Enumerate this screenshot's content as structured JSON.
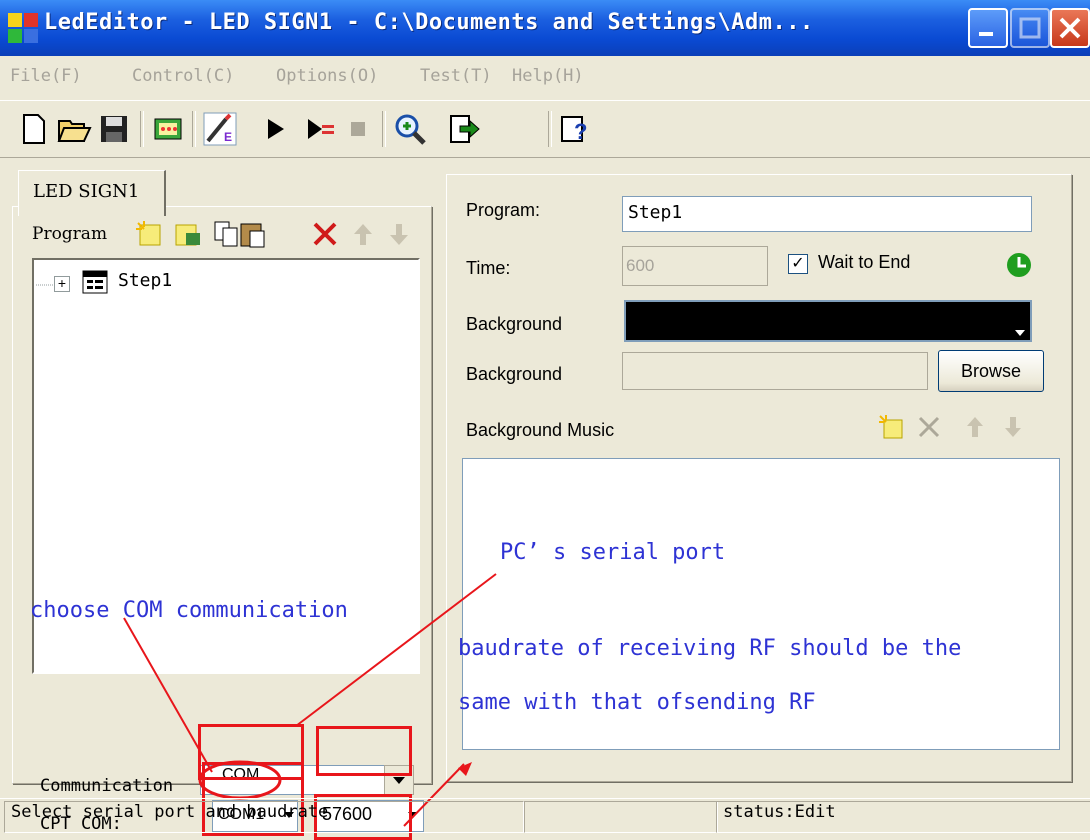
{
  "window": {
    "title": "LedEditor - LED SIGN1 - C:\\Documents and Settings\\Adm...",
    "icons": {
      "app": "led-app-icon",
      "minimize": "minimize-icon",
      "maximize": "maximize-icon",
      "close": "close-icon"
    }
  },
  "menu": [
    "File(F)",
    "Control(C)",
    "Options(O)",
    "Test(T)",
    "Help(H)"
  ],
  "toolbar": [
    "new-file-icon",
    "open-folder-icon",
    "save-disk-icon",
    "led-display-icon",
    "edit-wand-icon",
    "play-icon",
    "step-play-icon",
    "stop-icon",
    "zoom-icon",
    "export-icon",
    "help-icon"
  ],
  "left_panel": {
    "tab": "LED SIGN1",
    "program_label": "Program",
    "program_icons": [
      "new-program-icon",
      "new-sub-icon",
      "copy-icon",
      "paste-icon",
      "delete-icon",
      "move-up-icon",
      "move-down-icon"
    ],
    "tree": {
      "expander": "+",
      "item": "Step1"
    },
    "communication_label": "Communication",
    "communication_value": "COM",
    "cpt_label": "CPT COM:",
    "port_value": "COM1",
    "baud_value": "57600"
  },
  "right_panel": {
    "program_label": "Program:",
    "program_value": "Step1",
    "time_label": "Time:",
    "time_value": "600",
    "wait_checked": "✓",
    "wait_label": "Wait to End",
    "background_label1": "Background",
    "background_color": "#000000",
    "background_label2": "Background",
    "browse": "Browse",
    "music_label": "Background Music",
    "music_icons": [
      "add-music-icon",
      "delete-music-icon",
      "music-up-icon",
      "music-down-icon"
    ]
  },
  "annotations": {
    "serial_port": "PC’ s serial port",
    "choose_com": "choose COM communication",
    "baud_line1": "baudrate of receiving RF should be the",
    "baud_line2": "same with that ofsending RF"
  },
  "statusbar": {
    "message": "Select serial port and baudrate",
    "middle": "",
    "status": "status:Edit"
  },
  "colors": {
    "titlebar": "#0a4ad3",
    "annotation": "#2e33d4",
    "highlight": "#e8161b",
    "chrome": "#ece9d8"
  }
}
